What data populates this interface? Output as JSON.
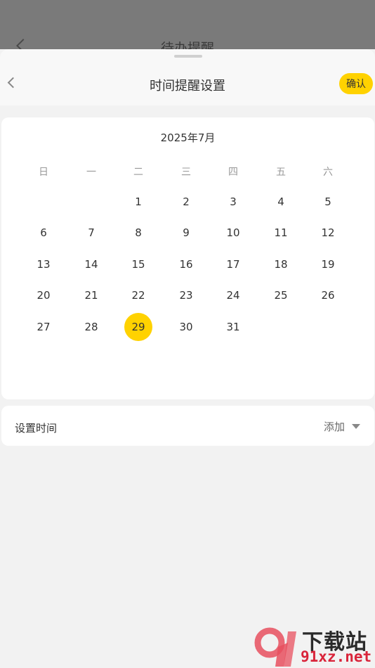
{
  "background_page": {
    "title": "待办提醒"
  },
  "sheet": {
    "title": "时间提醒设置",
    "confirm_label": "确认"
  },
  "calendar": {
    "month_title": "2025年7月",
    "weekdays": [
      "日",
      "一",
      "二",
      "三",
      "四",
      "五",
      "六"
    ],
    "days": [
      "1",
      "2",
      "3",
      "4",
      "5",
      "6",
      "7",
      "8",
      "9",
      "10",
      "11",
      "12",
      "13",
      "14",
      "15",
      "16",
      "17",
      "18",
      "19",
      "20",
      "21",
      "22",
      "23",
      "24",
      "25",
      "26",
      "27",
      "28",
      "29",
      "30",
      "31"
    ],
    "selected_day": "29",
    "accent_color": "#ffd200"
  },
  "time_row": {
    "label": "设置时间",
    "add_label": "添加"
  },
  "watermark": {
    "top_text": "下载站",
    "bottom_text": "91xz.net"
  }
}
